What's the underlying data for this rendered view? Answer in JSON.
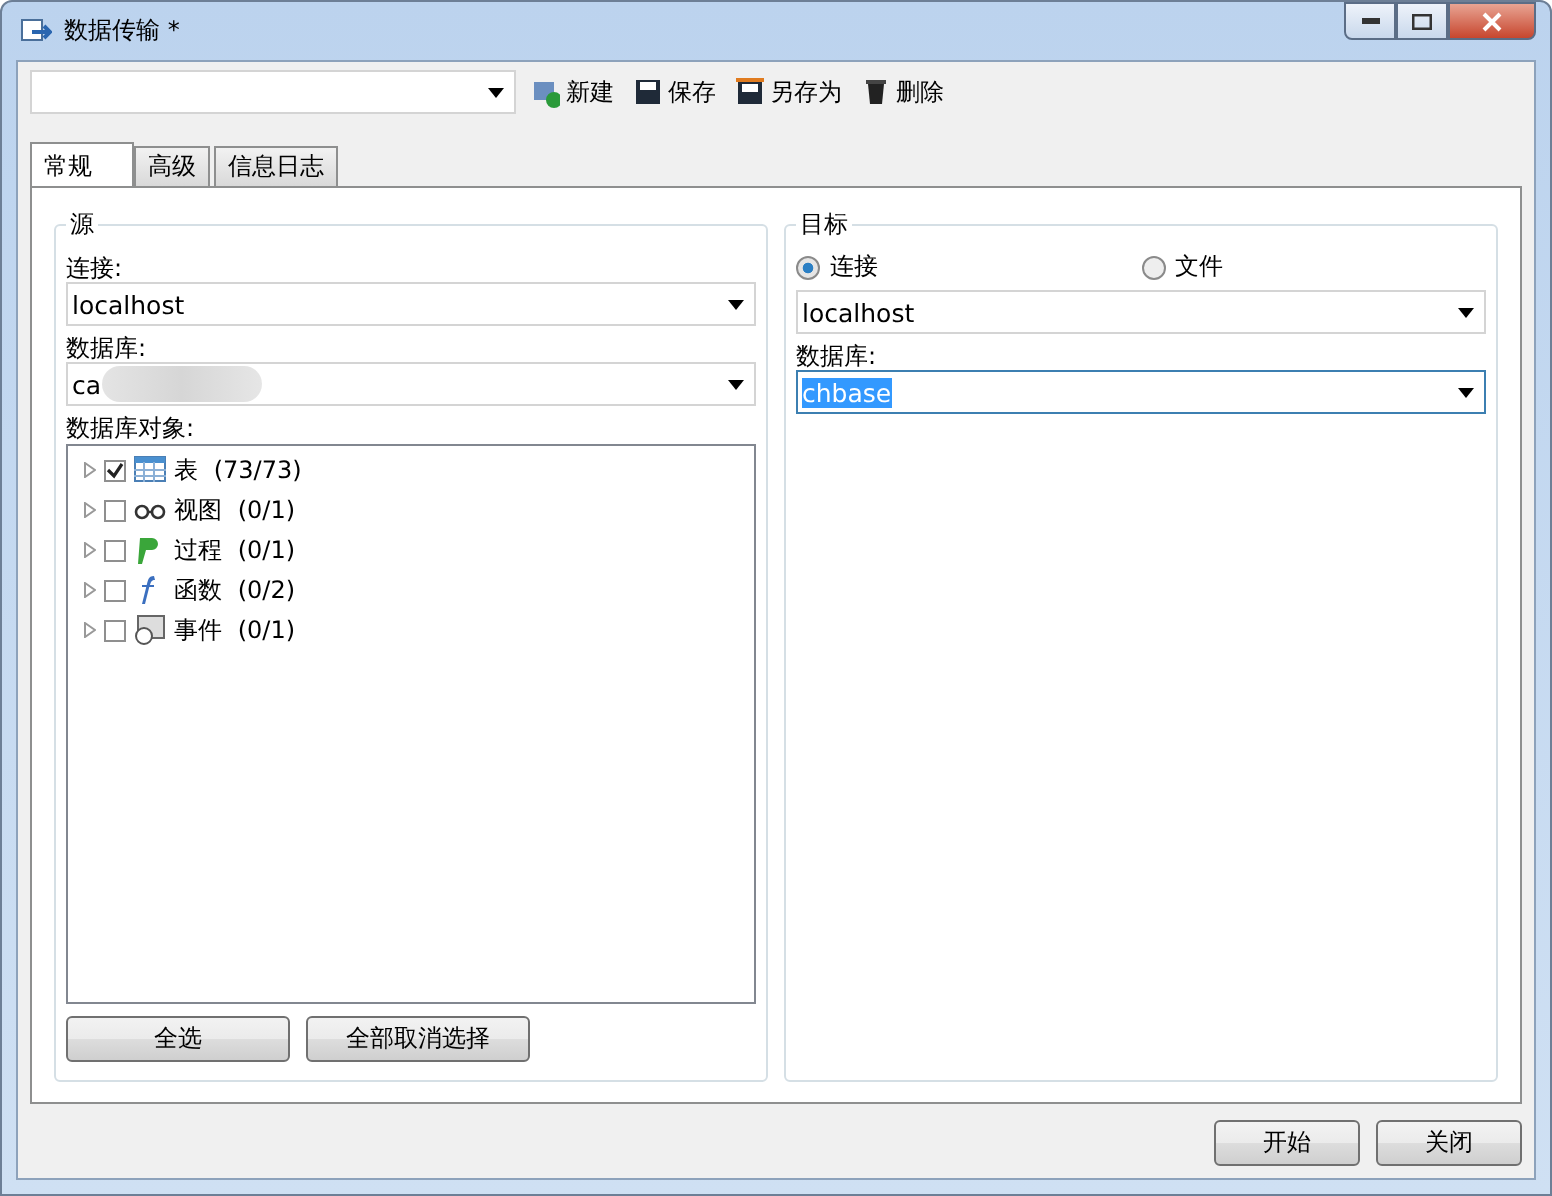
{
  "window": {
    "title": "数据传输 *"
  },
  "toolbar": {
    "buttons": [
      {
        "kind": "new",
        "label": "新建"
      },
      {
        "kind": "save",
        "label": "保存"
      },
      {
        "kind": "saveas",
        "label": "另存为"
      },
      {
        "kind": "delete",
        "label": "删除"
      }
    ]
  },
  "tabs": [
    {
      "label": "常规",
      "selected": true
    },
    {
      "label": "高级",
      "selected": false
    },
    {
      "label": "信息日志",
      "selected": false
    }
  ],
  "source": {
    "title": "源",
    "connection_label": "连接:",
    "connection": "localhost",
    "database_label": "数据库:",
    "database": "ca",
    "objects_label": "数据库对象:",
    "objects": [
      {
        "kind": "table",
        "label": "表",
        "count": "(73/73)",
        "checked": true
      },
      {
        "kind": "view",
        "label": "视图",
        "count": "(0/1)",
        "checked": false
      },
      {
        "kind": "procedure",
        "label": "过程",
        "count": "(0/1)",
        "checked": false
      },
      {
        "kind": "function",
        "label": "函数",
        "count": "(0/2)",
        "checked": false
      },
      {
        "kind": "event",
        "label": "事件",
        "count": "(0/1)",
        "checked": false
      }
    ],
    "buttons": [
      "全选",
      "全部取消选择"
    ]
  },
  "target": {
    "title": "目标",
    "modes": [
      {
        "label": "连接",
        "selected": true
      },
      {
        "label": "文件",
        "selected": false
      }
    ],
    "connection": "localhost",
    "database_label": "数据库:",
    "database": "chbase",
    "database_highlighted": true
  },
  "footer": {
    "buttons": [
      "开始",
      "关闭"
    ]
  }
}
